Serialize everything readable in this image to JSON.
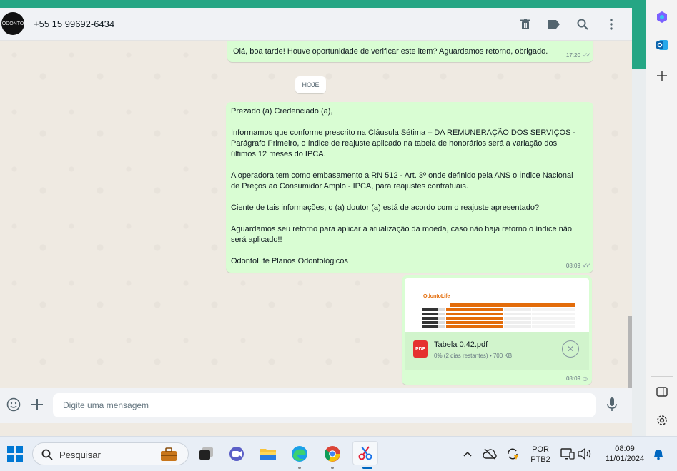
{
  "colors": {
    "accent": "#25a684",
    "bubble_out": "#d9fdd3",
    "chat_bg": "#efeae2",
    "pdf_red": "#e5312f"
  },
  "header": {
    "avatar_text": "ODONTO",
    "contact": "+55 15 99692-6434",
    "icons": [
      "trash-icon",
      "label-icon",
      "search-icon",
      "menu-dots-icon"
    ]
  },
  "messages": {
    "first": {
      "text": "Olá, boa tarde! Houve oportunidade de verificar este item? Aguardamos retorno, obrigado.",
      "time": "17:20"
    },
    "date_chip": "HOJE",
    "second": {
      "p1": "Prezado (a) Credenciado (a),",
      "p2": "Informamos que conforme prescrito na Cláusula Sétima – DA REMUNERAÇÃO DOS SERVIÇOS - Parágrafo Primeiro, o índice de reajuste aplicado na tabela de honorários será a variação dos últimos 12 meses do IPCA.",
      "p3": "A operadora tem como embasamento a RN 512 - Art. 3º onde definido pela ANS o Índice Nacional de Preços ao Consumidor Amplo - IPCA, para reajustes contratuais.",
      "p4": "Ciente de tais informações, o (a) doutor (a) está de acordo com o reajuste apresentado?",
      "p5": "Aguardamos seu retorno para aplicar a atualização da moeda, caso não haja retorno o índice não será aplicado!!",
      "p6": "OdontoLife Planos Odontológicos",
      "time": "08:09"
    },
    "attachment": {
      "file_name": "Tabela 0.42.pdf",
      "file_info": "0% (2 dias restantes) • 700 KB",
      "badge": "PDF",
      "preview_logo": "OdontoLife",
      "time": "08:09"
    }
  },
  "composer": {
    "placeholder": "Digite uma mensagem"
  },
  "taskbar": {
    "search_label": "Pesquisar",
    "lang_top": "POR",
    "lang_bottom": "PTB2",
    "time": "08:09",
    "date": "11/01/2024"
  }
}
